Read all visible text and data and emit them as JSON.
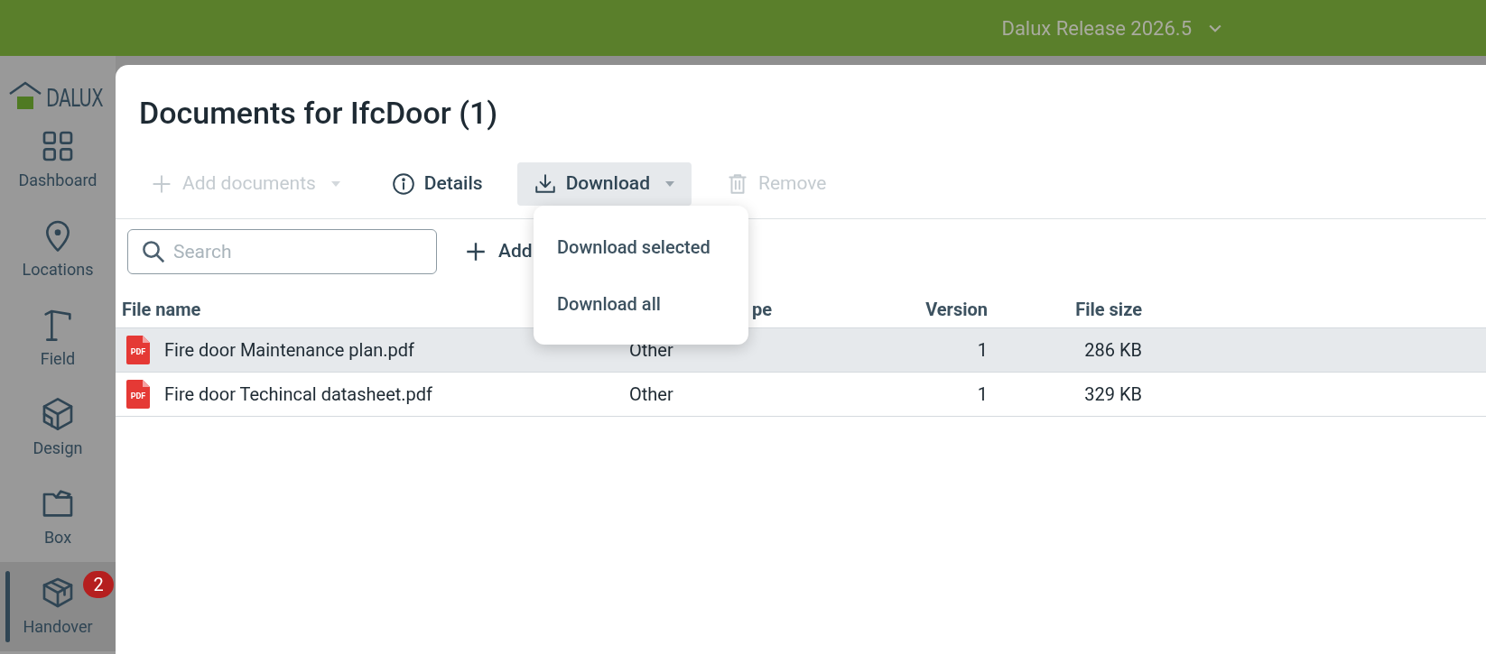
{
  "top_bar": {
    "release": "Dalux Release 2026.5"
  },
  "sidebar": {
    "logo": "DALUX",
    "items": [
      {
        "kind": "dashboard",
        "label": "Dashboard",
        "selected": false
      },
      {
        "kind": "locations",
        "label": "Locations",
        "selected": false
      },
      {
        "kind": "field",
        "label": "Field",
        "selected": false
      },
      {
        "kind": "design",
        "label": "Design",
        "selected": false
      },
      {
        "kind": "box",
        "label": "Box",
        "selected": false
      },
      {
        "kind": "handover",
        "label": "Handover",
        "selected": true,
        "badge": "2"
      }
    ]
  },
  "dialog": {
    "title": "Documents for IfcDoor (1)",
    "toolbar": [
      {
        "kind": "add",
        "label": "Add documents",
        "disabled": true,
        "dropdown": true,
        "expanded": false
      },
      {
        "kind": "details",
        "label": "Details",
        "disabled": false,
        "dropdown": false,
        "expanded": false
      },
      {
        "kind": "download",
        "label": "Download",
        "disabled": false,
        "dropdown": true,
        "expanded": true
      },
      {
        "kind": "remove",
        "label": "Remove",
        "disabled": true,
        "dropdown": false,
        "expanded": false
      }
    ],
    "menu": [
      "Download selected",
      "Download all"
    ],
    "search": {
      "placeholder": "Search"
    },
    "add_button": "Add",
    "table": {
      "columns": [
        "File name",
        "pe",
        "Version",
        "File size"
      ],
      "rows": [
        {
          "selected": true,
          "icon_label": "PDF",
          "cells": [
            "Fire door Maintenance plan.pdf",
            "Other",
            "1",
            "286 KB"
          ]
        },
        {
          "selected": false,
          "icon_label": "PDF",
          "cells": [
            "Fire door Techincal datasheet.pdf",
            "Other",
            "1",
            "329 KB"
          ]
        }
      ]
    }
  }
}
